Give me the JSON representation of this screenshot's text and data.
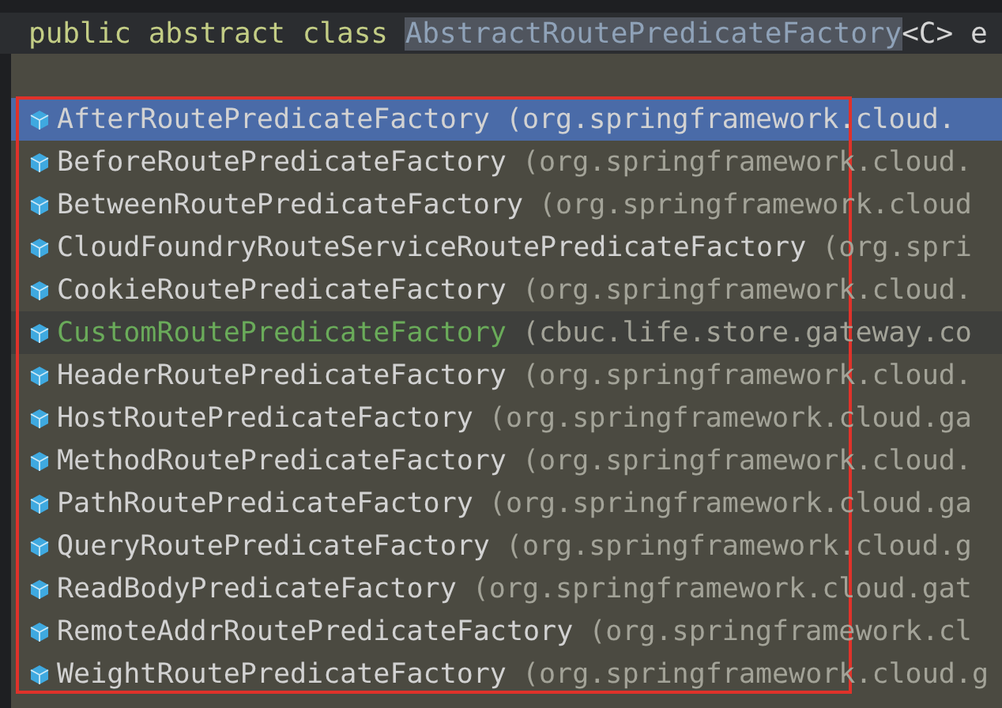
{
  "editor": {
    "keywords": [
      "public",
      "abstract",
      "class"
    ],
    "class_name": "AbstractRoutePredicateFactory",
    "suffix": "<C> e"
  },
  "completion": {
    "items": [
      {
        "name": "AfterRoutePredicateFactory",
        "package": "(org.springframework.cloud.",
        "kind": "library",
        "selected": true,
        "hovered": false
      },
      {
        "name": "BeforeRoutePredicateFactory",
        "package": "(org.springframework.cloud.",
        "kind": "library",
        "selected": false,
        "hovered": false
      },
      {
        "name": "BetweenRoutePredicateFactory",
        "package": "(org.springframework.cloud",
        "kind": "library",
        "selected": false,
        "hovered": false
      },
      {
        "name": "CloudFoundryRouteServiceRoutePredicateFactory",
        "package": "(org.spri",
        "kind": "library",
        "selected": false,
        "hovered": false
      },
      {
        "name": "CookieRoutePredicateFactory",
        "package": "(org.springframework.cloud.",
        "kind": "library",
        "selected": false,
        "hovered": false
      },
      {
        "name": "CustomRoutePredicateFactory",
        "package": "(cbuc.life.store.gateway.co",
        "kind": "project",
        "selected": false,
        "hovered": true
      },
      {
        "name": "HeaderRoutePredicateFactory",
        "package": "(org.springframework.cloud.",
        "kind": "library",
        "selected": false,
        "hovered": false
      },
      {
        "name": "HostRoutePredicateFactory",
        "package": "(org.springframework.cloud.ga",
        "kind": "library",
        "selected": false,
        "hovered": false
      },
      {
        "name": "MethodRoutePredicateFactory",
        "package": "(org.springframework.cloud.",
        "kind": "library",
        "selected": false,
        "hovered": false
      },
      {
        "name": "PathRoutePredicateFactory",
        "package": "(org.springframework.cloud.ga",
        "kind": "library",
        "selected": false,
        "hovered": false
      },
      {
        "name": "QueryRoutePredicateFactory",
        "package": "(org.springframework.cloud.g",
        "kind": "library",
        "selected": false,
        "hovered": false
      },
      {
        "name": "ReadBodyPredicateFactory",
        "package": "(org.springframework.cloud.gat",
        "kind": "library",
        "selected": false,
        "hovered": false
      },
      {
        "name": "RemoteAddrRoutePredicateFactory",
        "package": "(org.springframework.cl",
        "kind": "library",
        "selected": false,
        "hovered": false
      },
      {
        "name": "WeightRoutePredicateFactory",
        "package": "(org.springframework.cloud.g",
        "kind": "library",
        "selected": false,
        "hovered": false
      }
    ]
  }
}
